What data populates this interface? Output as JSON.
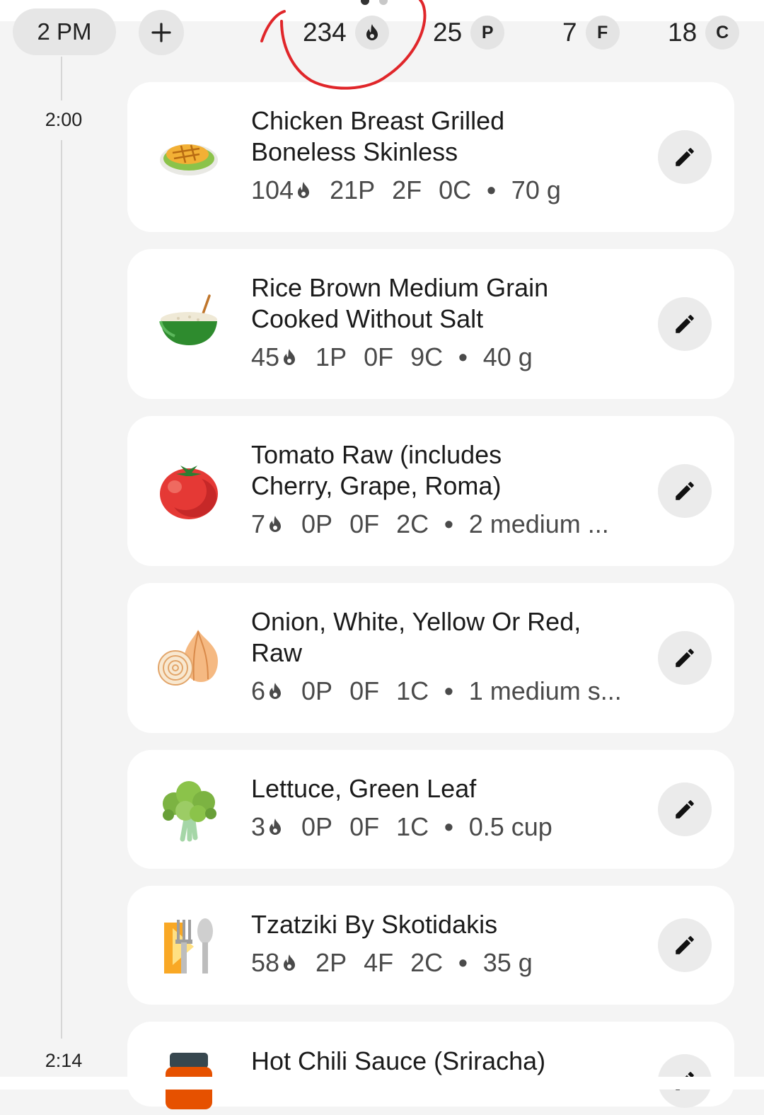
{
  "header": {
    "time_pill": "2 PM",
    "add_label": "+",
    "calories_total": "234",
    "protein_total": "25",
    "protein_badge": "P",
    "fat_total": "7",
    "fat_badge": "F",
    "carbs_total": "18",
    "carbs_badge": "C"
  },
  "timeline": {
    "start_label": "2:00",
    "end_label": "2:14"
  },
  "entries": [
    {
      "name_line1": "Chicken Breast Grilled",
      "name_line2": "Boneless Skinless",
      "calories": "104",
      "protein": "21P",
      "fat": "2F",
      "carbs": "0C",
      "amount": "70 g",
      "icon": "grilled-chicken-icon"
    },
    {
      "name_line1": "Rice Brown Medium Grain",
      "name_line2": "Cooked Without Salt",
      "calories": "45",
      "protein": "1P",
      "fat": "0F",
      "carbs": "9C",
      "amount": "40 g",
      "icon": "rice-bowl-icon"
    },
    {
      "name_line1": "Tomato Raw (includes",
      "name_line2": "Cherry, Grape, Roma)",
      "calories": "7",
      "protein": "0P",
      "fat": "0F",
      "carbs": "2C",
      "amount": "2 medium ...",
      "icon": "tomato-icon"
    },
    {
      "name_line1": "Onion, White, Yellow Or Red,",
      "name_line2": "Raw",
      "calories": "6",
      "protein": "0P",
      "fat": "0F",
      "carbs": "1C",
      "amount": "1 medium s...",
      "icon": "onion-icon"
    },
    {
      "name_line1": "Lettuce, Green Leaf",
      "name_line2": "",
      "calories": "3",
      "protein": "0P",
      "fat": "0F",
      "carbs": "1C",
      "amount": "0.5 cup",
      "icon": "lettuce-icon"
    },
    {
      "name_line1": "Tzatziki By Skotidakis",
      "name_line2": "",
      "calories": "58",
      "protein": "2P",
      "fat": "4F",
      "carbs": "2C",
      "amount": "35 g",
      "icon": "cutlery-icon"
    },
    {
      "name_line1": "Hot Chili Sauce (Sriracha)",
      "name_line2": "",
      "icon": "sauce-jar-icon"
    }
  ],
  "colors": {
    "annotation": "#e0262a",
    "card": "#ffffff",
    "background": "#f4f4f4"
  }
}
